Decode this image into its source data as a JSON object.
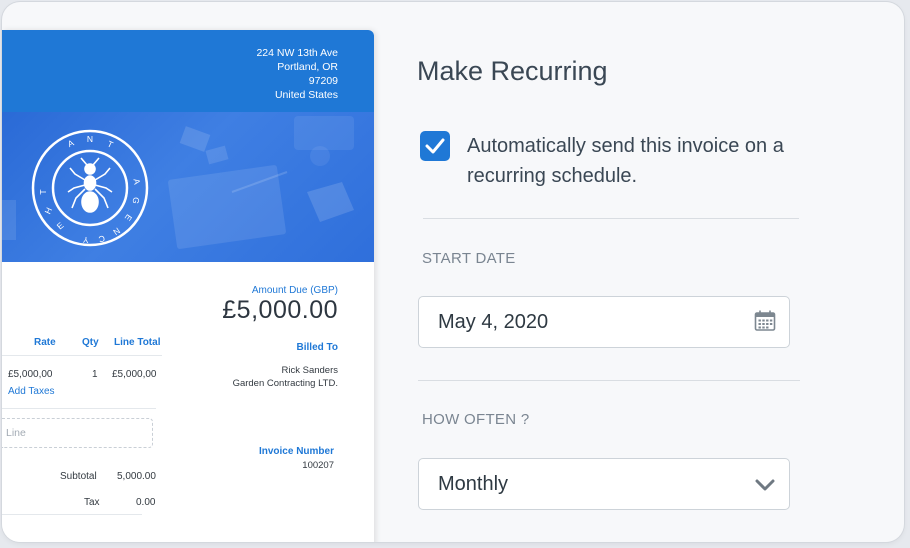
{
  "invoice": {
    "address": [
      "224 NW 13th Ave",
      "Portland, OR",
      "97209",
      "United States"
    ],
    "logo_text": "THE ANT AGENCY",
    "amount_due_label": "Amount Due (GBP)",
    "amount_due": "£5,000.00",
    "columns": {
      "rate": "Rate",
      "qty": "Qty",
      "line_total": "Line Total"
    },
    "line_item": {
      "rate": "£5,000,00",
      "qty": "1",
      "line_total": "£5,000,00"
    },
    "add_taxes": "Add Taxes",
    "add_line_placeholder": "Line",
    "subtotal_label": "Subtotal",
    "subtotal_value": "5,000.00",
    "tax_label": "Tax",
    "tax_value": "0.00",
    "billed_to_label": "Billed To",
    "billed_to": [
      "Rick Sanders",
      "Garden Contracting LTD."
    ],
    "invoice_number_label": "Invoice Number",
    "invoice_number": "100207",
    "brand_color": "#1f78d6"
  },
  "recurring": {
    "title": "Make Recurring",
    "auto_send_checked": true,
    "auto_send_label": "Automatically send this invoice on a recurring schedule.",
    "start_date_label": "START DATE",
    "start_date_value": "May 4, 2020",
    "start_date_icon": "calendar-icon",
    "how_often_label": "HOW OFTEN ?",
    "how_often_value": "Monthly",
    "how_often_icon": "chevron-down-icon"
  }
}
